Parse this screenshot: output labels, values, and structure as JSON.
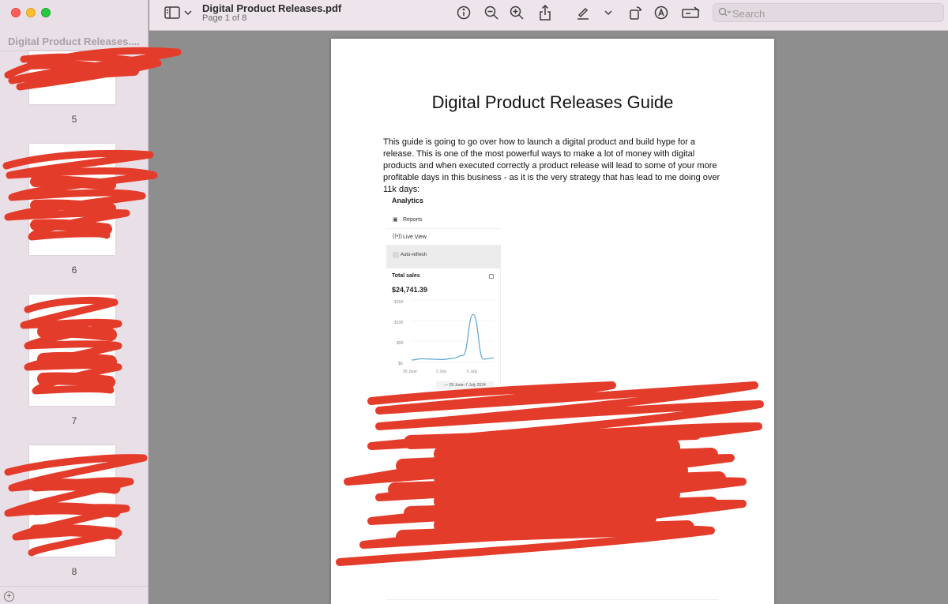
{
  "window": {
    "title": "Digital Product Releases.pdf",
    "subtitle": "Page 1 of 8"
  },
  "sidebar": {
    "title": "Digital Product Releases....",
    "thumbnails": [
      {
        "page": "5"
      },
      {
        "page": "6"
      },
      {
        "page": "7"
      },
      {
        "page": "8"
      }
    ],
    "add_icon": "plus-circle-icon"
  },
  "toolbar": {
    "icons": [
      "sidebar-icon",
      "chevron-down-icon",
      "info-icon",
      "zoom-out-icon",
      "zoom-in-icon",
      "share-icon",
      "markup-pen-icon",
      "chevron-down-icon",
      "rotate-icon",
      "markup-icon",
      "form-fill-icon"
    ],
    "search_placeholder": "Search"
  },
  "document": {
    "heading": "Digital Product Releases Guide",
    "intro": "This guide is going to go over how to launch a digital product and build hype for a release. This is one of the most powerful ways to make a lot of money with digital products and when executed correctly a product release will lead to some of your more profitable days in this business - as it is the very strategy that has lead to me doing over 11k days:",
    "analytics": {
      "title": "Analytics",
      "nav": [
        {
          "label": "Reports",
          "icon": "reports-icon"
        },
        {
          "label": "Live View",
          "icon": "live-icon"
        }
      ],
      "auto_refresh": "Auto-refresh",
      "total_label": "Total sales",
      "total_value": "$24,741.39",
      "date_range": "29 June–7 July 2024"
    }
  },
  "chart_data": {
    "type": "line",
    "title": "Total sales",
    "x_tick_labels": [
      "29 June",
      "2 July",
      "5 July"
    ],
    "y_tick_labels": [
      "$15K",
      "$10K",
      "$5K",
      "$0"
    ],
    "ylim": [
      0,
      15000
    ],
    "x": [
      "29 June",
      "30 June",
      "1 July",
      "2 July",
      "3 July",
      "4 July",
      "5 July",
      "6 July",
      "7 July"
    ],
    "series": [
      {
        "values": [
          400,
          700,
          600,
          500,
          800,
          1500,
          11500,
          600,
          900
        ]
      }
    ],
    "color": "#5aa6d6",
    "grid": true
  }
}
